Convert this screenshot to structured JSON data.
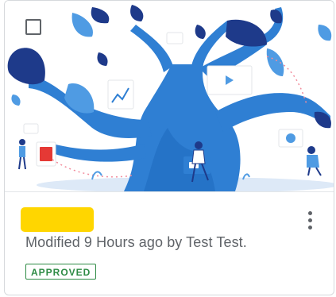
{
  "card": {
    "thumbnail_icon": "tree-illustration",
    "checkbox_icon": "checkbox-unchecked-icon",
    "more_icon": "more-vertical-icon",
    "name_highlight_color": "#ffd600",
    "modified_text": "Modified 9 Hours ago by Test Test.",
    "status_label": "APPROVED",
    "status_color": "#2e8b45",
    "accent_blue": "#2f7fd3",
    "accent_navy": "#1e3a8a"
  }
}
